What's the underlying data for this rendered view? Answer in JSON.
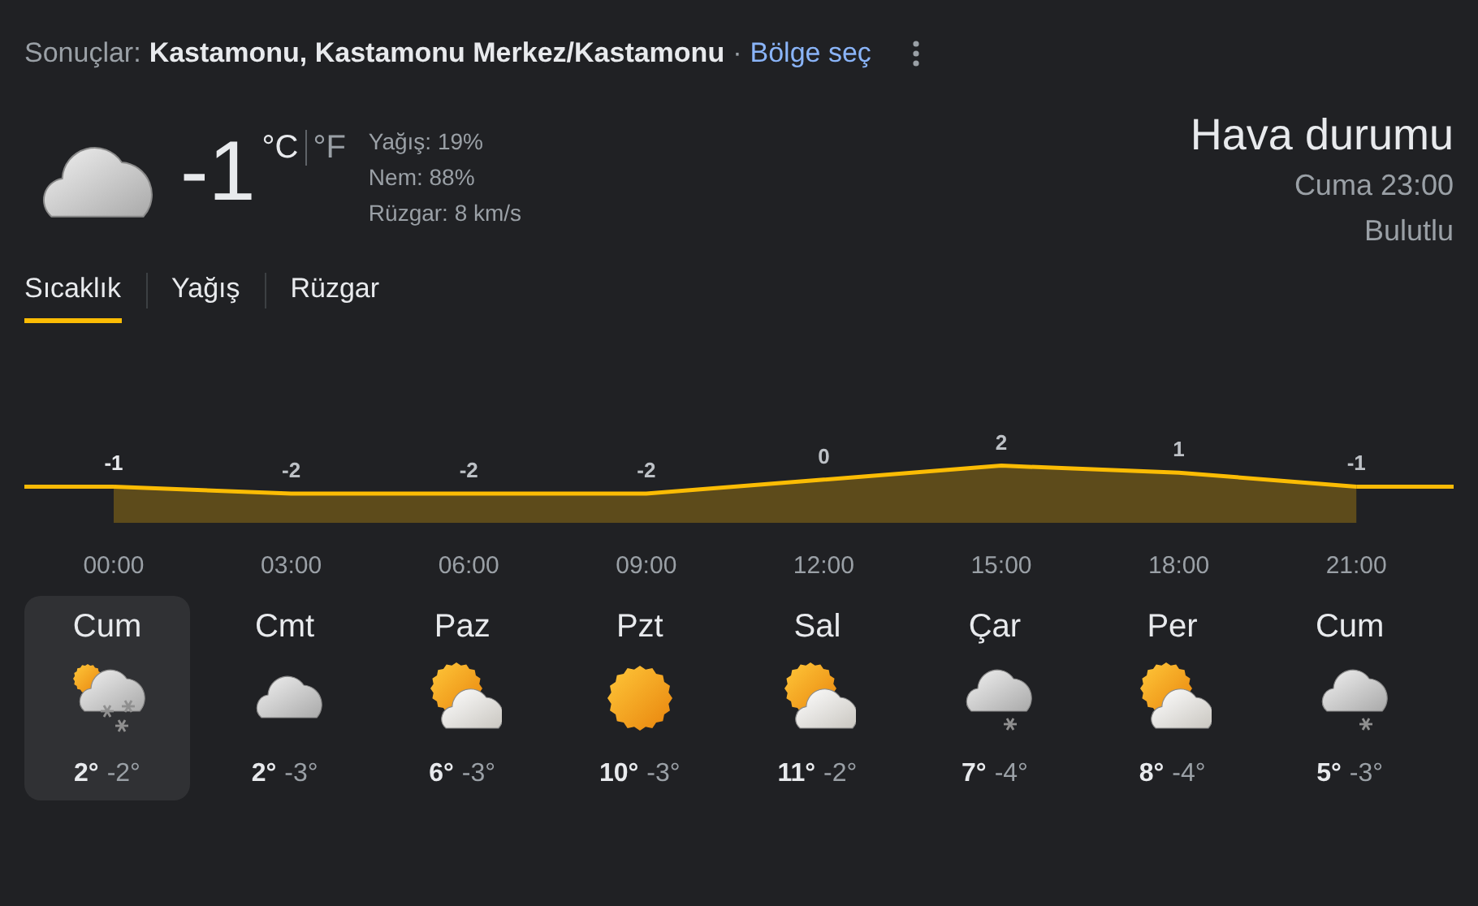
{
  "header": {
    "prefix": "Sonuçlar:",
    "location": "Kastamonu, Kastamonu Merkez/Kastamonu",
    "separator": "·",
    "link": "Bölge seç"
  },
  "current": {
    "temperature": "-1",
    "units": [
      {
        "label": "°C",
        "selected": true
      },
      {
        "label": "°F",
        "selected": false
      }
    ],
    "details": [
      "Yağış: 19%",
      "Nem: 88%",
      "Rüzgar: 8 km/s"
    ],
    "title": "Hava durumu",
    "time": "Cuma 23:00",
    "condition": "Bulutlu"
  },
  "tabs": [
    {
      "label": "Sıcaklık",
      "selected": true
    },
    {
      "label": "Yağış",
      "selected": false
    },
    {
      "label": "Rüzgar",
      "selected": false
    }
  ],
  "chart_data": {
    "type": "area",
    "categories": [
      "00:00",
      "03:00",
      "06:00",
      "09:00",
      "12:00",
      "15:00",
      "18:00",
      "21:00"
    ],
    "series": [
      {
        "color": "#fbbc04",
        "values": [
          -1,
          -2,
          -2,
          -2,
          0,
          2,
          1,
          -1
        ]
      }
    ],
    "data_labels": true
  },
  "days": [
    {
      "name": "Cum",
      "kind": "snow-partly",
      "high": "2°",
      "low": "-2°",
      "selected": true
    },
    {
      "name": "Cmt",
      "kind": "cloudy",
      "high": "2°",
      "low": "-3°",
      "selected": false
    },
    {
      "name": "Paz",
      "kind": "partly-sunny",
      "high": "6°",
      "low": "-3°",
      "selected": false
    },
    {
      "name": "Pzt",
      "kind": "sunny",
      "high": "10°",
      "low": "-3°",
      "selected": false
    },
    {
      "name": "Sal",
      "kind": "partly-sunny",
      "high": "11°",
      "low": "-2°",
      "selected": false
    },
    {
      "name": "Çar",
      "kind": "snow-cloudy",
      "high": "7°",
      "low": "-4°",
      "selected": false
    },
    {
      "name": "Per",
      "kind": "partly-sunny",
      "high": "8°",
      "low": "-4°",
      "selected": false
    },
    {
      "name": "Cum",
      "kind": "snow-cloudy",
      "high": "5°",
      "low": "-3°",
      "selected": false
    }
  ]
}
